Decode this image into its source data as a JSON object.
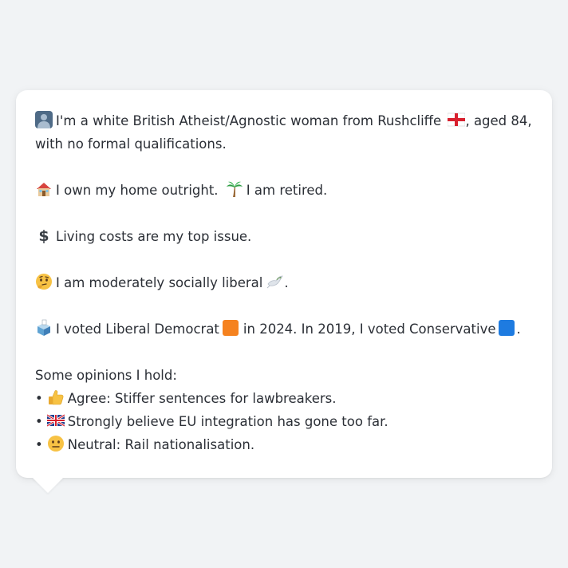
{
  "profile": {
    "intro_text": "I'm a white British Atheist/Agnostic woman from Rushcliffe",
    "intro_tail": ", aged 84, with no formal qualifications.",
    "home_text": "I own my home outright.",
    "work_text": "I am retired.",
    "issue_text": "Living costs are my top issue.",
    "social_text": "I am moderately socially liberal",
    "social_tail": ".",
    "vote_2024_text": "I voted Liberal Democrat",
    "vote_2019_text": "in 2024. In 2019, I voted Conservative",
    "vote_tail": "."
  },
  "opinions": {
    "heading": "Some opinions I hold:",
    "bullet_char": "•",
    "items": [
      {
        "icon": "thumbs-up-icon",
        "text": "Agree: Stiffer sentences for lawbreakers."
      },
      {
        "icon": "uk-flag-icon",
        "text": "Strongly believe EU integration has gone too far."
      },
      {
        "icon": "neutral-face-icon",
        "text": "Neutral: Rail nationalisation."
      }
    ]
  },
  "colors": {
    "background": "#f1f3f5",
    "card": "#ffffff",
    "text": "#2b2f36",
    "lib_dem": "#f5821f",
    "conservative": "#1e7be0"
  },
  "icons": {
    "person": "person-silhouette-icon",
    "england_flag": "england-flag-icon",
    "house": "house-icon",
    "palm": "palm-tree-icon",
    "dollar": "dollar-sign-icon",
    "thinking": "thinking-face-icon",
    "dove": "dove-icon",
    "ballot": "ballot-box-icon"
  }
}
